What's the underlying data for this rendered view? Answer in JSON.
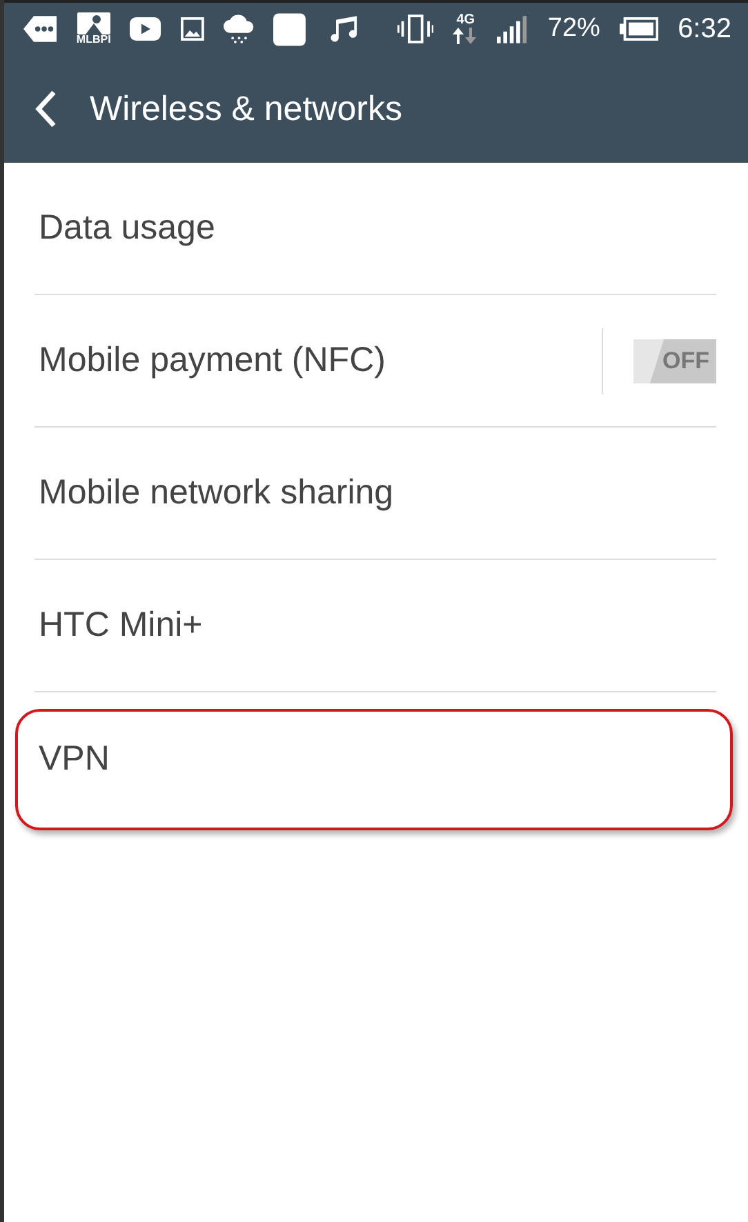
{
  "status_bar": {
    "app_label": "MLBPI",
    "network": "4G",
    "battery": "72%",
    "time": "6:32"
  },
  "app_bar": {
    "title": "Wireless & networks"
  },
  "items": [
    {
      "label": "Data usage",
      "kind": "plain",
      "highlighted": false
    },
    {
      "label": "Mobile payment (NFC)",
      "kind": "toggle",
      "on": false,
      "toggle_text": "OFF",
      "highlighted": false
    },
    {
      "label": "Mobile network sharing",
      "kind": "plain",
      "highlighted": false
    },
    {
      "label": "HTC Mini+",
      "kind": "plain",
      "highlighted": false
    },
    {
      "label": "VPN",
      "kind": "plain",
      "highlighted": true
    }
  ]
}
